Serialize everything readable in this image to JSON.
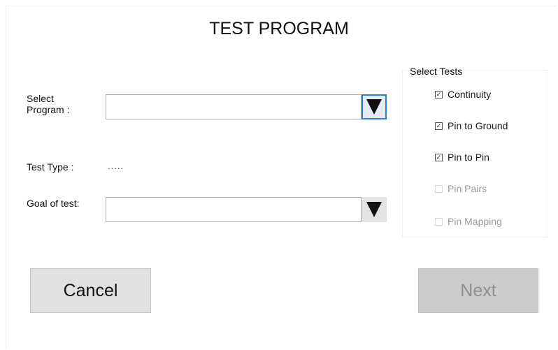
{
  "title": "TEST PROGRAM",
  "form": {
    "program_label": "Select\nProgram :",
    "program_value": "",
    "test_type_label": "Test Type :",
    "test_type_value": ".....",
    "goal_label": "Goal of test:",
    "goal_value": ""
  },
  "tests": {
    "group_title": "Select Tests",
    "items": [
      {
        "label": "Continuity",
        "checked": true,
        "enabled": true
      },
      {
        "label": "Pin to Ground",
        "checked": true,
        "enabled": true
      },
      {
        "label": "Pin to Pin",
        "checked": true,
        "enabled": true
      },
      {
        "label": "Pin Pairs",
        "checked": false,
        "enabled": false
      },
      {
        "label": "Pin Mapping",
        "checked": false,
        "enabled": false
      }
    ]
  },
  "buttons": {
    "cancel_label": "Cancel",
    "next_label": "Next"
  },
  "icons": {
    "dropdown": "triangle-down-icon",
    "check": "checkbox-checked-icon"
  },
  "colors": {
    "focus_border": "#2f7fd6",
    "disabled_text": "#9a9a9a"
  }
}
